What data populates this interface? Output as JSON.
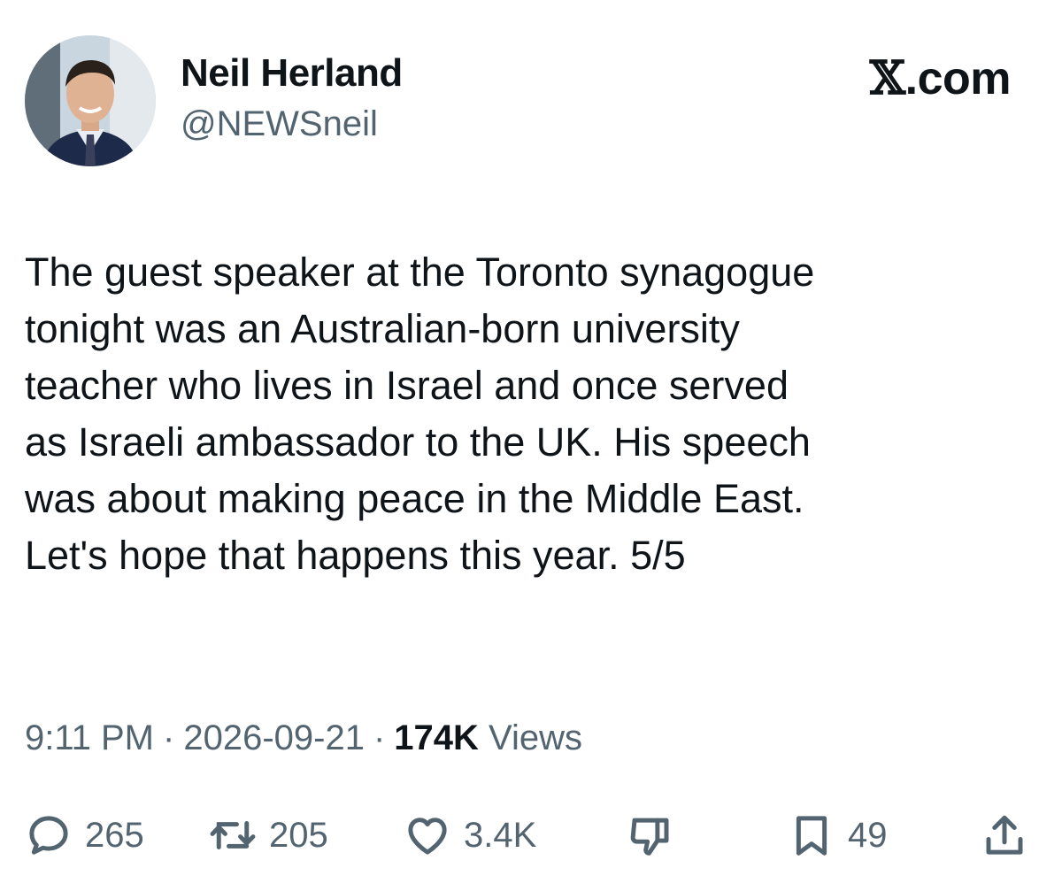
{
  "author": {
    "display_name": "Neil Herland",
    "handle": "@NEWSneil"
  },
  "brand": {
    "x_glyph": "𝕏",
    "suffix": ".com"
  },
  "tweet": {
    "text": "The guest speaker at the Toronto synagogue\ntonight was an Australian-born university\nteacher who lives in Israel and once served\nas Israeli ambassador to the UK. His speech\nwas about making peace in the Middle East.\nLet's hope that happens this year. 5/5"
  },
  "meta": {
    "time": "9:11 PM",
    "date": "2026-09-21",
    "views_count": "174K",
    "views_label": "Views",
    "separator": "·"
  },
  "actions": {
    "replies": "265",
    "reposts": "205",
    "likes": "3.4K",
    "bookmarks": "49"
  },
  "icons": {
    "reply": "reply-icon",
    "repost": "repost-icon",
    "like": "heart-icon",
    "dislike": "thumbs-down-icon",
    "bookmark": "bookmark-icon",
    "share": "share-icon"
  },
  "colors": {
    "text": "#0f1419",
    "secondary": "#536471"
  }
}
